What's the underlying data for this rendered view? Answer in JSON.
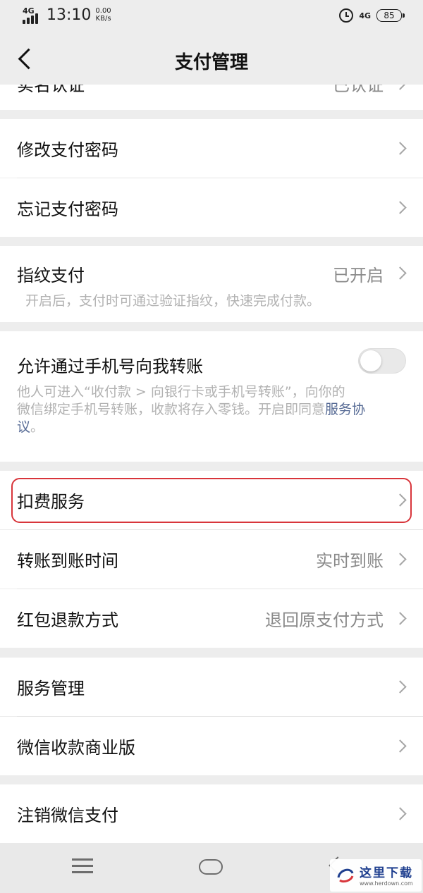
{
  "status_bar": {
    "network": "4G",
    "time": "13:10",
    "speed_value": "0.00",
    "speed_unit": "KB/s",
    "net_right": "4G",
    "battery": "85"
  },
  "nav": {
    "title": "支付管理"
  },
  "sections": {
    "realname": {
      "label": "实名认证",
      "value": "已认证"
    },
    "password": {
      "change": "修改支付密码",
      "forgot": "忘记支付密码"
    },
    "fingerprint": {
      "label": "指纹支付",
      "value": "已开启",
      "desc": "开启后，支付时可通过验证指纹，快速完成付款。"
    },
    "phone_transfer": {
      "label": "允许通过手机号向我转账",
      "toggle_on": false,
      "desc_line1": "他人可进入“收付款 > 向银行卡或手机号转账”，向你的",
      "desc_line2_text": "微信绑定手机号转账，收款将存入零钱。开启即同意",
      "desc_link_part1": "服务协",
      "desc_link_part2": "议",
      "desc_end": "。"
    },
    "services": {
      "deduct": "扣费服务",
      "transfer_time": {
        "label": "转账到账时间",
        "value": "实时到账"
      },
      "refund": {
        "label": "红包退款方式",
        "value": "退回原支付方式"
      }
    },
    "manage": {
      "service_manage": "服务管理",
      "business": "微信收款商业版"
    },
    "cancel": {
      "label": "注销微信支付"
    }
  },
  "watermark": {
    "text": "这里下载",
    "url": "www.herdown.com"
  },
  "colors": {
    "highlight": "#d8353b",
    "link": "#576b95"
  }
}
